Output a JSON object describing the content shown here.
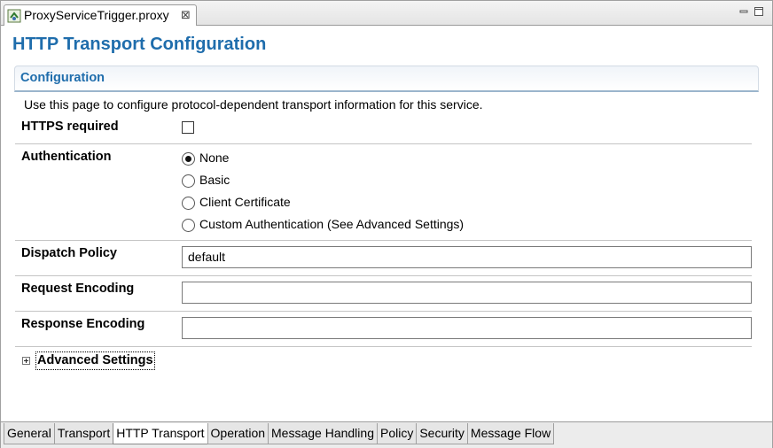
{
  "editor": {
    "tab_title": "ProxyServiceTrigger.proxy",
    "close_glyph": "⊠",
    "file_icon": "proxy-file-icon",
    "window_controls": [
      "minimize-icon",
      "maximize-icon"
    ]
  },
  "page": {
    "title": "HTTP Transport Configuration",
    "section_title": "Configuration",
    "description": "Use this page to configure protocol-dependent transport information for this service."
  },
  "form": {
    "https_required": {
      "label": "HTTPS required",
      "checked": false
    },
    "authentication": {
      "label": "Authentication",
      "selected": "None",
      "options": [
        "None",
        "Basic",
        "Client Certificate",
        "Custom Authentication (See Advanced Settings)"
      ]
    },
    "dispatch_policy": {
      "label": "Dispatch Policy",
      "value": "default"
    },
    "request_encoding": {
      "label": "Request Encoding",
      "value": ""
    },
    "response_encoding": {
      "label": "Response Encoding",
      "value": ""
    },
    "advanced_settings": {
      "label": "Advanced Settings",
      "expanded": false
    }
  },
  "bottom_tabs": [
    "General",
    "Transport",
    "HTTP Transport",
    "Operation",
    "Message Handling",
    "Policy",
    "Security",
    "Message Flow"
  ],
  "active_tab": "HTTP Transport",
  "colors": {
    "title": "#1f6dac",
    "section_rule": "#9bb5cc"
  }
}
